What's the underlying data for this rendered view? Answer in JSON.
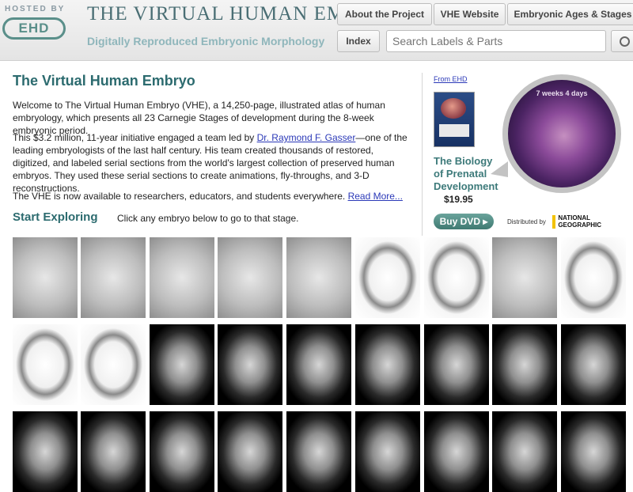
{
  "header": {
    "hosted_by": "HOSTED BY",
    "logo_text": "EHD",
    "title": "THE VIRTUAL HUMAN EMBRYO",
    "subtitle": "Digitally Reproduced Embryonic Morphology"
  },
  "nav": {
    "items": [
      {
        "label": "About the Project"
      },
      {
        "label": "VHE Website"
      },
      {
        "label": "Embryonic Ages & Stages"
      }
    ],
    "index_label": "Index",
    "search_placeholder": "Search Labels & Parts",
    "search_icon": "magnifier-icon"
  },
  "main": {
    "title": "The Virtual Human Embryo",
    "intro": "Welcome to The Virtual Human Embryo (VHE), a 14,250-page, illustrated atlas of human embryology, which presents all 23 Carnegie Stages of development during the 8-week embryonic period.",
    "para2_before": "This $3.2 million, 11-year initiative engaged a team led by ",
    "para2_link": "Dr. Raymond F. Gasser",
    "para2_after": "—one of the leading embryologists of the last half century. His team created thousands of restored, digitized, and labeled serial sections from the world's largest collection of preserved human embryos. They used these serial sections to create animations, fly-throughs, and 3-D reconstructions.",
    "para3": "The VHE is now available to researchers, educators, and students everywhere. ",
    "read_more": "Read More...",
    "start_heading": "Start Exploring",
    "start_hint": "Click any embryo below to go to that stage."
  },
  "sidebar": {
    "from_label": "From EHD",
    "dvd_icon": "dvd-cover-icon",
    "book_title": "The Biology of Prenatal Development",
    "price": "$19.95",
    "buy_label": "Buy DVD ▸",
    "distributed_by": "Distributed by",
    "natgeo": "NATIONAL GEOGRAPHIC",
    "embryo_age": "7 weeks 4 days"
  },
  "thumbnails": {
    "row1": [
      "light",
      "light",
      "light",
      "light",
      "light",
      "line",
      "line",
      "light",
      "line"
    ],
    "row2": [
      "line",
      "line",
      "dark",
      "dark",
      "dark",
      "dark",
      "dark",
      "dark",
      "dark"
    ],
    "row3": [
      "dark",
      "dark",
      "dark",
      "dark",
      "dark",
      "dark",
      "dark",
      "dark",
      "dark"
    ]
  },
  "colors": {
    "accent": "#2c6b6f",
    "link": "#2b39b8",
    "title_gray": "#4a6e74",
    "subtitle": "#8fb6bb",
    "buy_button": "#4f8b83"
  }
}
